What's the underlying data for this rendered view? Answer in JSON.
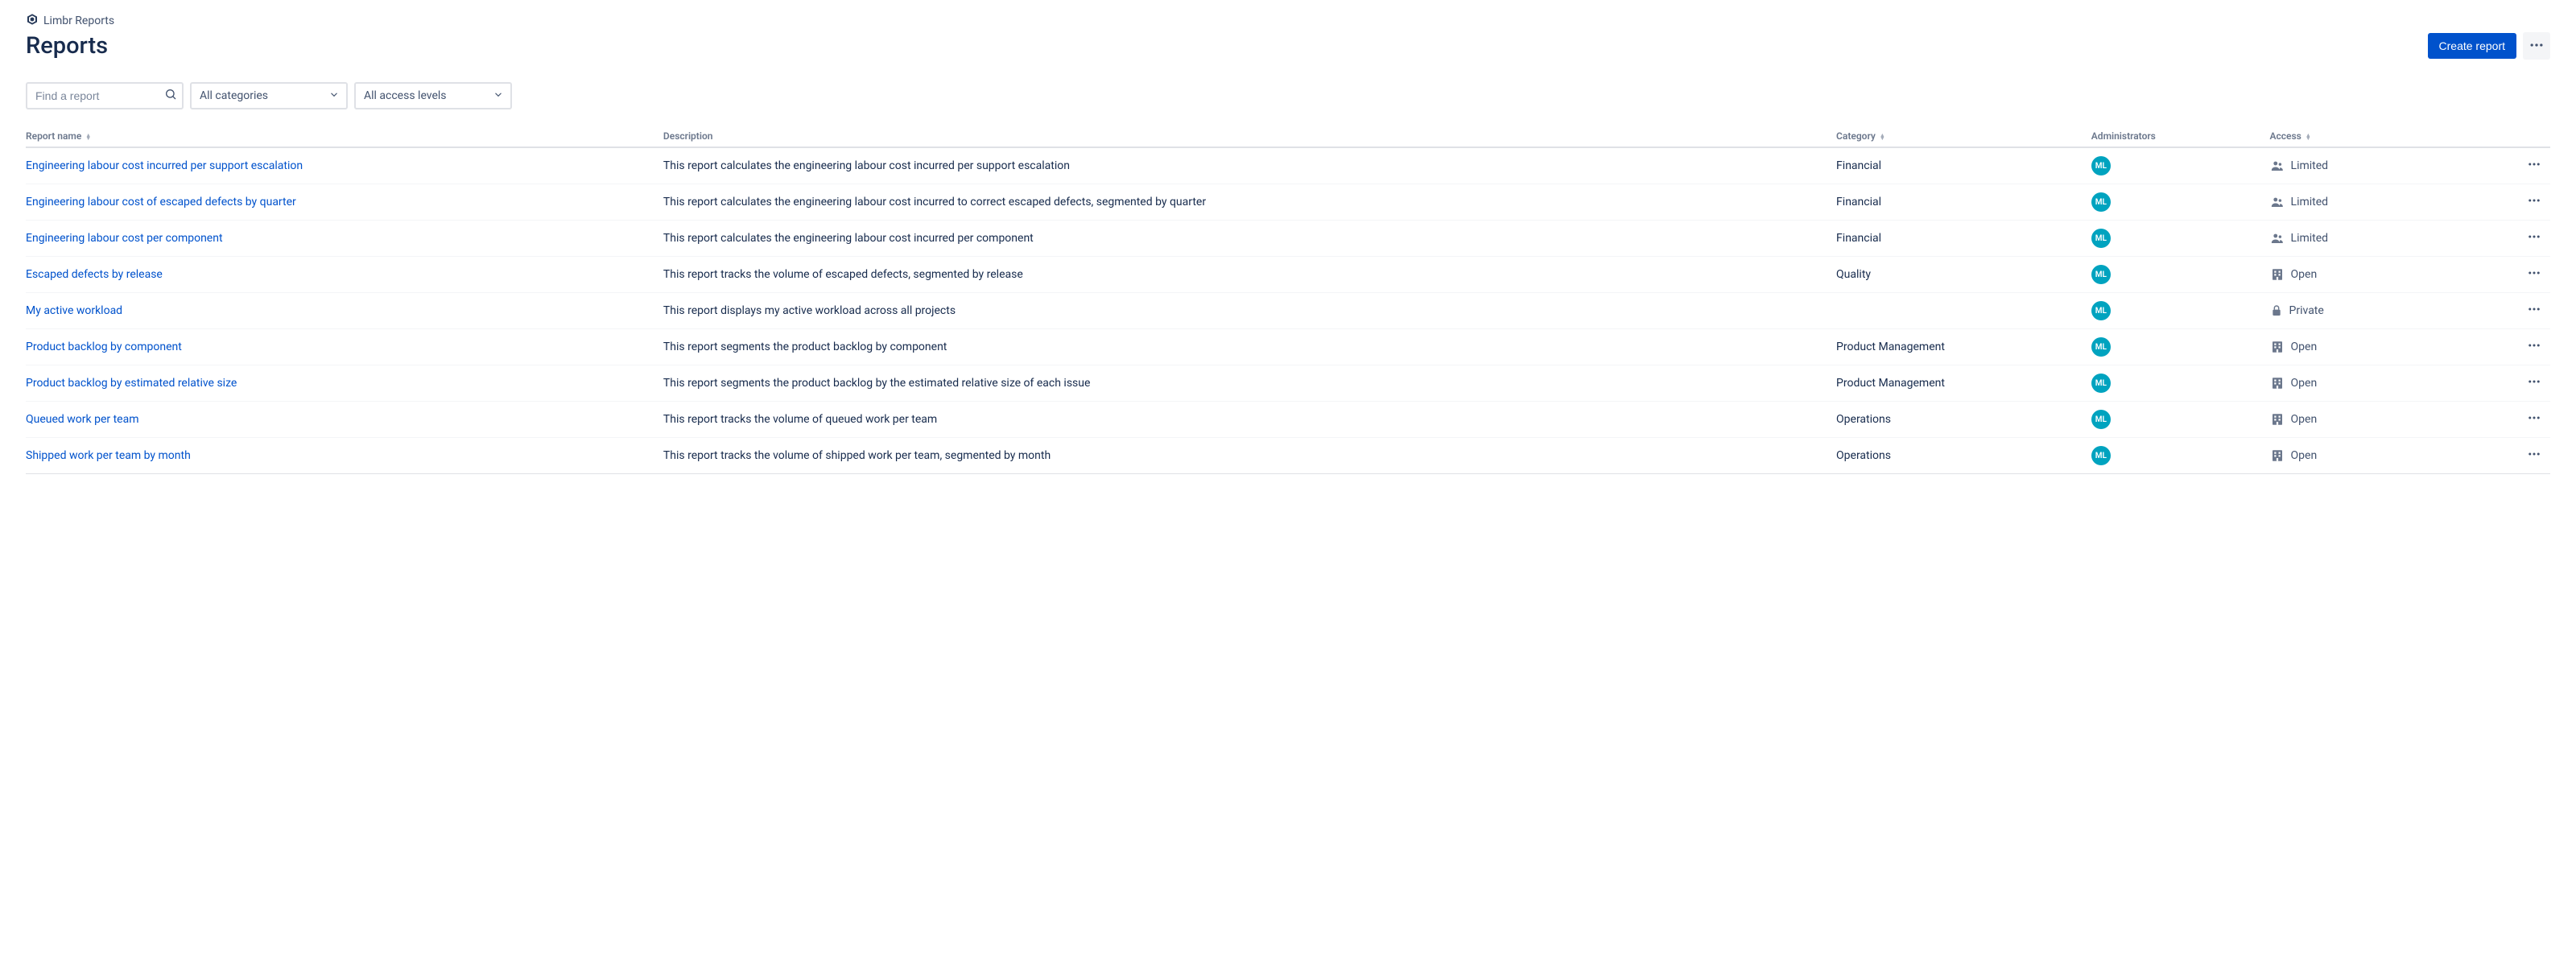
{
  "breadcrumb": {
    "label": "Limbr Reports"
  },
  "page": {
    "title": "Reports"
  },
  "actions": {
    "create_label": "Create report"
  },
  "filters": {
    "search_placeholder": "Find a report",
    "category_selected": "All categories",
    "access_selected": "All access levels"
  },
  "table": {
    "headers": {
      "name": "Report name",
      "description": "Description",
      "category": "Category",
      "administrators": "Administrators",
      "access": "Access"
    },
    "admin_initials": "ML",
    "rows": [
      {
        "name": "Engineering labour cost incurred per support escalation",
        "description": "This report calculates the engineering labour cost incurred per support escalation",
        "category": "Financial",
        "access": "Limited",
        "access_icon": "group"
      },
      {
        "name": "Engineering labour cost of escaped defects by quarter",
        "description": "This report calculates the engineering labour cost incurred to correct escaped defects, segmented by quarter",
        "category": "Financial",
        "access": "Limited",
        "access_icon": "group"
      },
      {
        "name": "Engineering labour cost per component",
        "description": "This report calculates the engineering labour cost incurred per component",
        "category": "Financial",
        "access": "Limited",
        "access_icon": "group"
      },
      {
        "name": "Escaped defects by release",
        "description": "This report tracks the volume of escaped defects, segmented by release",
        "category": "Quality",
        "access": "Open",
        "access_icon": "building"
      },
      {
        "name": "My active workload",
        "description": "This report displays my active workload across all projects",
        "category": "",
        "access": "Private",
        "access_icon": "lock"
      },
      {
        "name": "Product backlog by component",
        "description": "This report segments the product backlog by component",
        "category": "Product Management",
        "access": "Open",
        "access_icon": "building"
      },
      {
        "name": "Product backlog by estimated relative size",
        "description": "This report segments the product backlog by the estimated relative size of each issue",
        "category": "Product Management",
        "access": "Open",
        "access_icon": "building"
      },
      {
        "name": "Queued work per team",
        "description": "This report tracks the volume of queued work per team",
        "category": "Operations",
        "access": "Open",
        "access_icon": "building"
      },
      {
        "name": "Shipped work per team by month",
        "description": "This report tracks the volume of shipped work per team, segmented by month",
        "category": "Operations",
        "access": "Open",
        "access_icon": "building"
      }
    ]
  }
}
